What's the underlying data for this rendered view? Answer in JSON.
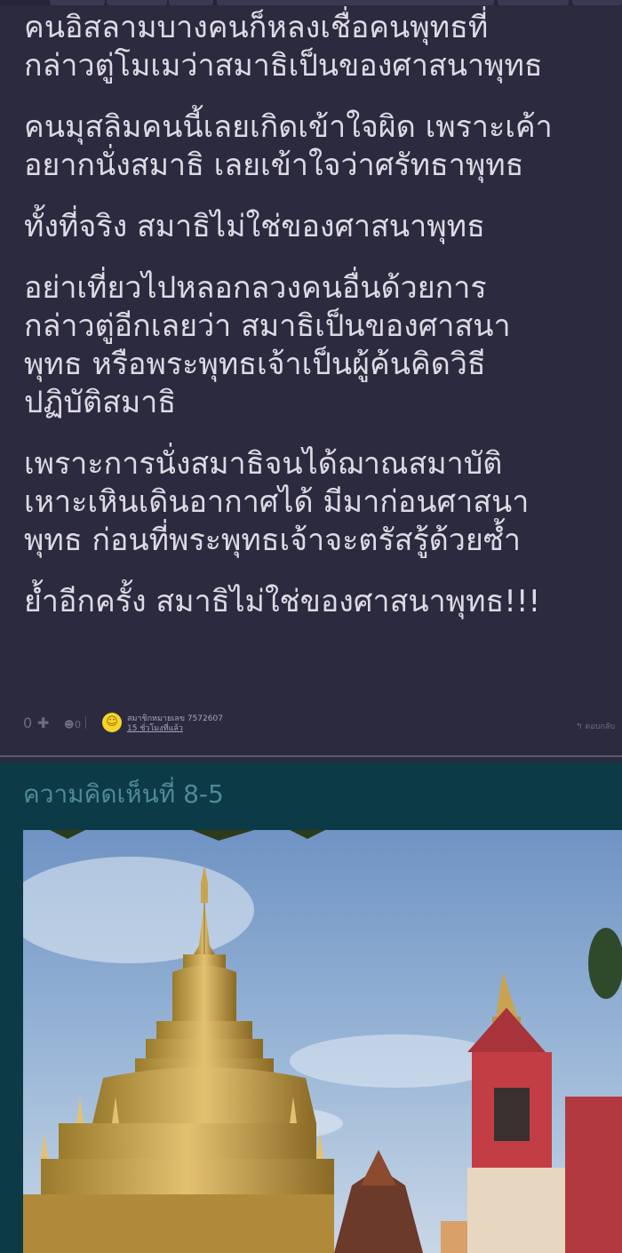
{
  "comment": {
    "paragraphs": [
      "คนอิสลามบางคนก็หลงเชื่อคนพุทธที่\nกล่าวตู่โมเมว่าสมาธิเป็นของศาสนาพุทธ",
      "คนมุสลิมคนนี้เลยเกิดเข้าใจผิด  เพราะเค้า\nอยากนั่งสมาธิ เลยเข้าใจว่าศรัทธาพุทธ",
      "ทั้งที่จริง สมาธิไม่ใช่ของศาสนาพุทธ",
      "อย่าเที่ยวไปหลอกลวงคนอื่นด้วยการ\nกล่าวตู่อีกเลยว่า สมาธิเป็นของศาสนา\nพุทธ หรือพระพุทธเจ้าเป็นผู้ค้นคิดวิธี\nปฏิบัติสมาธิ",
      "เพราะการนั่งสมาธิจนได้ฌาณสมาบัติ\nเหาะเหินเดินอากาศได้ มีมาก่อนศาสนา\nพุทธ  ก่อนที่พระพุทธเจ้าจะตรัสรู้ด้วยซ้ำ",
      "ย้ำอีกครั้ง สมาธิไม่ใช่ของศาสนาพุทธ!!!"
    ],
    "vote_count": "0",
    "plus_icon": "plus-icon",
    "emotion_count": "0",
    "member": "สมาชิกหมายเลข 7572607",
    "time": "15 ชั่วโมงที่แล้ว",
    "reply_label": "ตอบกลับ"
  },
  "next_comment": {
    "title": "ความคิดเห็นที่ 8-5"
  }
}
